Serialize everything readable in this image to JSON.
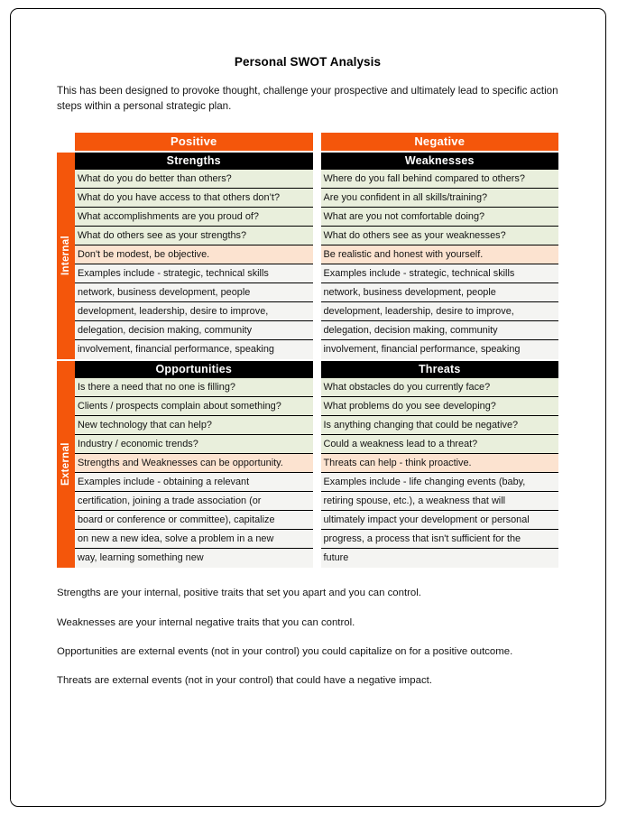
{
  "document": {
    "title": "Personal SWOT Analysis",
    "intro": "This has been designed to provoke thought, challenge your prospective and ultimately lead to specific action steps within a personal strategic plan."
  },
  "matrix": {
    "column_banners": [
      "Positive",
      "Negative"
    ],
    "row_axis_labels": [
      "Internal",
      "External"
    ],
    "quadrants": {
      "strengths": {
        "header": "Strengths",
        "prompts": [
          "What do you do better than others?",
          "What do you have access to that others don’t?",
          "What accomplishments are you proud of?",
          "What do others see as your strengths?"
        ],
        "tip": "Don't be modest, be objective.",
        "examples": [
          "Examples include - strategic, technical skills",
          "network, business development, people",
          "development, leadership, desire to improve,",
          "delegation, decision making, community",
          "involvement, financial performance, speaking"
        ]
      },
      "weaknesses": {
        "header": "Weaknesses",
        "prompts": [
          "Where do you fall behind compared to others?",
          "Are you confident in all skills/training?",
          "What are you not comfortable doing?",
          "What do others see as your weaknesses?"
        ],
        "tip": "Be realistic and honest with yourself.",
        "examples": [
          "Examples include - strategic, technical skills",
          "network, business development, people",
          "development, leadership, desire to improve,",
          "delegation, decision making, community",
          "involvement, financial performance, speaking"
        ]
      },
      "opportunities": {
        "header": "Opportunities",
        "prompts": [
          "Is there a need that no one is filling?",
          "Clients / prospects complain about something?",
          "New technology that can help?",
          "Industry / economic trends?"
        ],
        "tip": "Strengths and Weaknesses can be opportunity.",
        "examples": [
          "Examples include - obtaining a relevant",
          "certification, joining a trade association (or",
          "board or conference or committee), capitalize",
          "on new a new idea, solve a problem in a new",
          "way, learning something new"
        ]
      },
      "threats": {
        "header": "Threats",
        "prompts": [
          "What obstacles do you currently face?",
          "What problems do you see developing?",
          "Is anything changing that could be negative?",
          "Could a weakness lead to a threat?"
        ],
        "tip": "Threats can help - think proactive.",
        "examples": [
          "Examples include - life changing events (baby,",
          "retiring spouse, etc.), a weakness that will",
          "ultimately impact your development or personal",
          " progress, a process that isn't sufficient for the",
          "future"
        ]
      }
    }
  },
  "notes": [
    "Strengths are your internal, positive traits that set you apart and you can control.",
    "Weaknesses are your internal negative traits that you can control.",
    "Opportunities are external events (not in your control) you could capitalize on for a positive outcome.",
    "Threats are external events (not in your control) that could have a negative impact."
  ],
  "colors": {
    "accent_orange": "#F4560B",
    "header_black": "#000000",
    "prompt_green": "#E9EFDC",
    "tip_peach": "#FCE3D0",
    "example_plain": "#F4F4F2"
  }
}
